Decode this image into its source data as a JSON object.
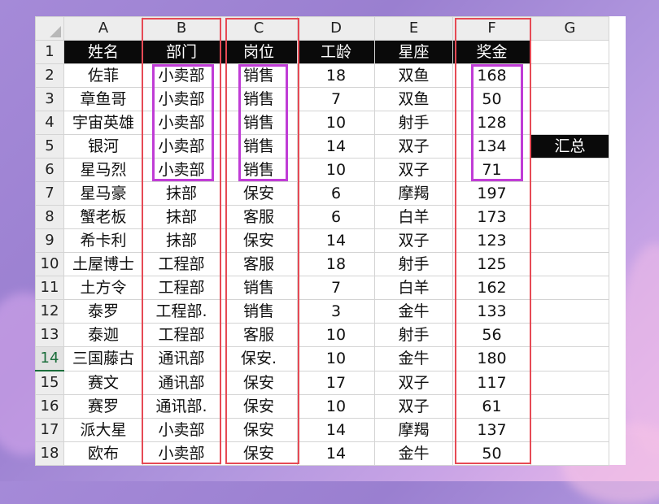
{
  "columns": [
    "A",
    "B",
    "C",
    "D",
    "E",
    "F",
    "G"
  ],
  "rows": [
    {
      "num": "1",
      "cells": [
        "姓名",
        "部门",
        "岗位",
        "工龄",
        "星座",
        "奖金",
        ""
      ]
    },
    {
      "num": "2",
      "cells": [
        "佐菲",
        "小卖部",
        "销售",
        "18",
        "双鱼",
        "168",
        ""
      ]
    },
    {
      "num": "3",
      "cells": [
        "章鱼哥",
        "小卖部",
        "销售",
        "7",
        "双鱼",
        "50",
        ""
      ]
    },
    {
      "num": "4",
      "cells": [
        "宇宙英雄",
        "小卖部",
        "销售",
        "10",
        "射手",
        "128",
        ""
      ]
    },
    {
      "num": "5",
      "cells": [
        "银河",
        "小卖部",
        "销售",
        "14",
        "双子",
        "134",
        "汇总"
      ]
    },
    {
      "num": "6",
      "cells": [
        "星马烈",
        "小卖部",
        "销售",
        "10",
        "双子",
        "71",
        ""
      ]
    },
    {
      "num": "7",
      "cells": [
        "星马豪",
        "抹部",
        "保安",
        "6",
        "摩羯",
        "197",
        ""
      ]
    },
    {
      "num": "8",
      "cells": [
        "蟹老板",
        "抹部",
        "客服",
        "6",
        "白羊",
        "173",
        ""
      ]
    },
    {
      "num": "9",
      "cells": [
        "希卡利",
        "抹部",
        "保安",
        "14",
        "双子",
        "123",
        ""
      ]
    },
    {
      "num": "10",
      "cells": [
        "土屋博士",
        "工程部",
        "客服",
        "18",
        "射手",
        "125",
        ""
      ]
    },
    {
      "num": "11",
      "cells": [
        "土方令",
        "工程部",
        "销售",
        "7",
        "白羊",
        "162",
        ""
      ]
    },
    {
      "num": "12",
      "cells": [
        "泰罗",
        "工程部.",
        "销售",
        "3",
        "金牛",
        "133",
        ""
      ]
    },
    {
      "num": "13",
      "cells": [
        "泰迦",
        "工程部",
        "客服",
        "10",
        "射手",
        "56",
        ""
      ]
    },
    {
      "num": "14",
      "cells": [
        "三国藤古",
        "通讯部",
        "保安.",
        "10",
        "金牛",
        "180",
        ""
      ]
    },
    {
      "num": "15",
      "cells": [
        "赛文",
        "通讯部",
        "保安",
        "17",
        "双子",
        "117",
        ""
      ]
    },
    {
      "num": "16",
      "cells": [
        "赛罗",
        "通讯部.",
        "保安",
        "10",
        "双子",
        "61",
        ""
      ]
    },
    {
      "num": "17",
      "cells": [
        "派大星",
        "小卖部",
        "保安",
        "14",
        "摩羯",
        "137",
        ""
      ]
    },
    {
      "num": "18",
      "cells": [
        "欧布",
        "小卖部",
        "保安",
        "14",
        "金牛",
        "50",
        ""
      ]
    }
  ],
  "active_row": "14",
  "colors": {
    "header_fill": "#0a0a0a",
    "header_text": "#ffffff",
    "column_highlight": "#e64a55",
    "range_highlight": "#c03cd6",
    "active_row_accent": "#1b6e3b"
  }
}
